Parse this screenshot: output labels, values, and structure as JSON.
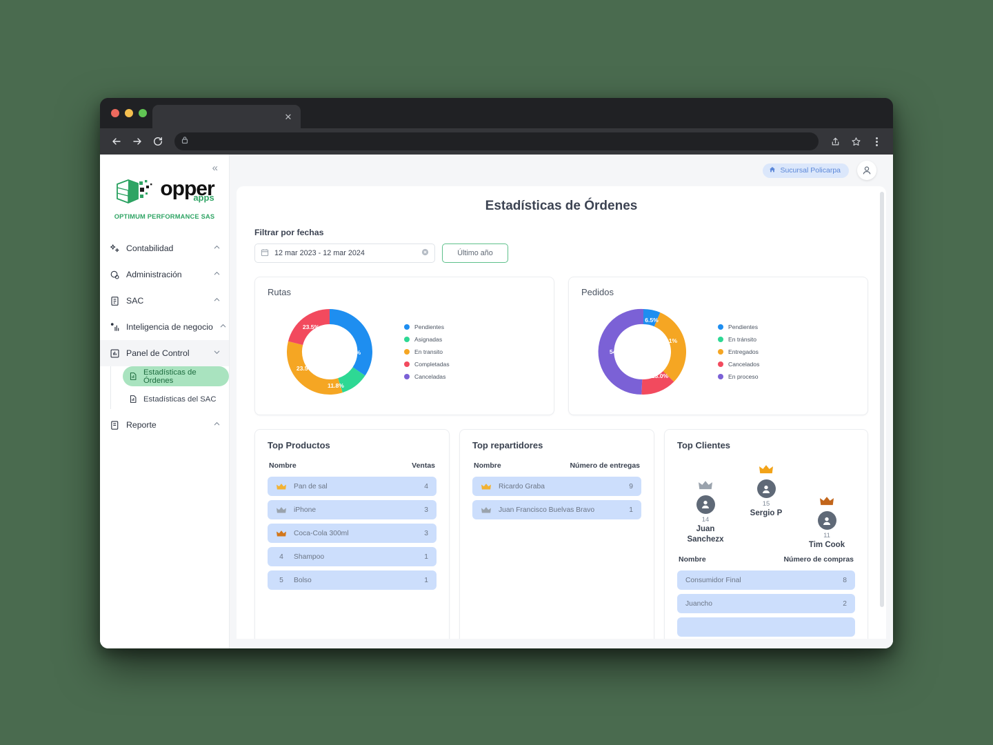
{
  "browser": {
    "tab_title": "",
    "tab_close_icon": "close-icon",
    "url": "",
    "lock_icon": "lock-icon",
    "back_icon": "back-arrow-icon",
    "forward_icon": "forward-arrow-icon",
    "reload_icon": "reload-icon",
    "share_icon": "share-icon",
    "bookmark_icon": "star-icon",
    "menu_icon": "three-dots-icon"
  },
  "sidebar": {
    "collapse_icon": "chevrons-left-icon",
    "brand": {
      "word_main": "opper",
      "word_sub": "apps",
      "company": "OPTIMUM PERFORMANCE SAS"
    },
    "items": [
      {
        "label": "Contabilidad",
        "icon": "sparkles-icon",
        "chevron": "chevron-up-icon",
        "expanded": false
      },
      {
        "label": "Administración",
        "icon": "settings-gear-icon",
        "chevron": "chevron-up-icon",
        "expanded": false
      },
      {
        "label": "SAC",
        "icon": "clipboard-icon",
        "chevron": "chevron-up-icon",
        "expanded": false
      },
      {
        "label": "Inteligencia de negocio",
        "icon": "bar-chart-icon",
        "chevron": "chevron-up-icon",
        "expanded": false
      },
      {
        "label": "Panel de Control",
        "icon": "dashboard-icon",
        "chevron": "chevron-down-icon",
        "expanded": true
      },
      {
        "label": "Reporte",
        "icon": "report-icon",
        "chevron": "chevron-up-icon",
        "expanded": false
      }
    ],
    "subitems": [
      {
        "label": "Estadísticas de Órdenes",
        "icon": "chart-document-icon",
        "selected": true
      },
      {
        "label": "Estadísticas del SAC",
        "icon": "chart-document-icon",
        "selected": false
      }
    ]
  },
  "topbar": {
    "branch_label": "Sucursal Policarpa",
    "branch_icon": "home-icon",
    "avatar_icon": "user-icon"
  },
  "main": {
    "title": "Estadísticas de Órdenes",
    "filter_label": "Filtrar por fechas",
    "date_range_value": "12 mar 2023 - 12 mar 2024",
    "date_calendar_icon": "calendar-icon",
    "date_clear_icon": "clear-circle-icon",
    "range_preset": "Último año"
  },
  "chart_data": [
    {
      "type": "pie",
      "title": "Rutas",
      "variant": "donut",
      "legend_position": "right",
      "categories": [
        "Pendientes",
        "Asignadas",
        "En transito",
        "Completadas",
        "Canceladas"
      ],
      "values": [
        41.2,
        11.8,
        23.5,
        23.5,
        0
      ],
      "value_unit": "%",
      "labels": [
        "41.2%",
        "11.8%",
        "23.5%",
        "23.5%",
        ""
      ],
      "colors": [
        "#1E8EF0",
        "#2ED894",
        "#F5A623",
        "#F24A5E",
        "#7B61D6"
      ]
    },
    {
      "type": "pie",
      "title": "Pedidos",
      "variant": "donut",
      "legend_position": "right",
      "categories": [
        "Pendientes",
        "En tránsito",
        "Entregados",
        "Cancelados",
        "En proceso"
      ],
      "values": [
        6.5,
        0,
        26.1,
        13.0,
        54.3
      ],
      "value_unit": "%",
      "labels": [
        "6.5%",
        "",
        "26.1%",
        "13.0%",
        "54.3%"
      ],
      "colors": [
        "#1E8EF0",
        "#2ED894",
        "#F5A623",
        "#F24A5E",
        "#7B61D6"
      ]
    }
  ],
  "top_productos": {
    "title": "Top Productos",
    "col_name": "Nombre",
    "col_value": "Ventas",
    "rows": [
      {
        "rank": "1",
        "medal": "gold",
        "name": "Pan de sal",
        "value": "4"
      },
      {
        "rank": "2",
        "medal": "silver",
        "name": "iPhone",
        "value": "3"
      },
      {
        "rank": "3",
        "medal": "bronze",
        "name": "Coca-Cola 300ml",
        "value": "3"
      },
      {
        "rank": "4",
        "medal": "",
        "name": "Shampoo",
        "value": "1"
      },
      {
        "rank": "5",
        "medal": "",
        "name": "Bolso",
        "value": "1"
      }
    ]
  },
  "top_repartidores": {
    "title": "Top repartidores",
    "col_name": "Nombre",
    "col_value": "Número de entregas",
    "rows": [
      {
        "rank": "1",
        "medal": "gold",
        "name": "Ricardo Graba",
        "value": "9"
      },
      {
        "rank": "2",
        "medal": "silver",
        "name": "Juan Francisco Buelvas Bravo",
        "value": "1"
      }
    ]
  },
  "top_clientes": {
    "title": "Top Clientes",
    "podium": [
      {
        "place": "second",
        "medal": "silver",
        "count": "14",
        "name": "Juan Sanchezx",
        "avatar_icon": "user-avatar-icon",
        "crown_icon": "crown-icon"
      },
      {
        "place": "first",
        "medal": "gold",
        "count": "15",
        "name": "Sergio P",
        "avatar_icon": "user-avatar-icon",
        "crown_icon": "crown-icon"
      },
      {
        "place": "third",
        "medal": "bronze",
        "count": "11",
        "name": "Tim Cook",
        "avatar_icon": "user-avatar-icon",
        "crown_icon": "crown-icon"
      }
    ],
    "col_name": "Nombre",
    "col_value": "Número de compras",
    "rows": [
      {
        "name": "Consumidor Final",
        "value": "8"
      },
      {
        "name": "Juancho",
        "value": "2"
      },
      {
        "name": "",
        "value": ""
      }
    ]
  },
  "colors": {
    "brand_green": "#2fa464",
    "accent_blue": "#1E8EF0",
    "accent_green": "#2ED894",
    "accent_orange": "#F5A623",
    "accent_red": "#F24A5E",
    "accent_purple": "#7B61D6",
    "row_bg": "#ccdefc",
    "selected_nav": "#a9e3bf",
    "page_bg": "#f5f6f8",
    "backdrop": "#4a6b4f"
  }
}
